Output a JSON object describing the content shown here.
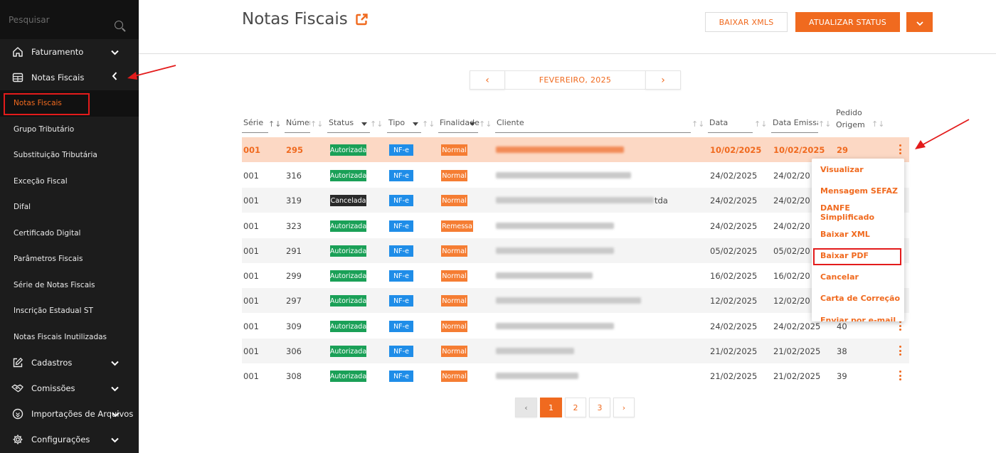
{
  "sidebar": {
    "search_placeholder": "Pesquisar",
    "groups_top": [
      {
        "label": "Faturamento",
        "icon": "home-icon"
      },
      {
        "label": "Notas Fiscais",
        "icon": "invoice-list-icon"
      }
    ],
    "subitems": [
      "Notas Fiscais",
      "Grupo Tributário",
      "Substituição Tributária",
      "Exceção Fiscal",
      "Difal",
      "Certificado Digital",
      "Parâmetros Fiscais",
      "Série de Notas Fiscais",
      "Inscrição Estadual ST",
      "Notas Fiscais Inutilizadas"
    ],
    "groups_bottom": [
      {
        "label": "Cadastros",
        "icon": "edit-icon"
      },
      {
        "label": "Comissões",
        "icon": "handshake-icon"
      },
      {
        "label": "Importações de Arquivos",
        "icon": "import-icon"
      },
      {
        "label": "Configurações",
        "icon": "gear-icon"
      }
    ]
  },
  "header": {
    "title": "Notas Fiscais",
    "download_xmls": "BAIXAR XMLS",
    "update_status": "ATUALIZAR STATUS"
  },
  "month_nav": {
    "label": "FEVEREIRO, 2025",
    "prev": "‹",
    "next": "›"
  },
  "table": {
    "columns": [
      "Série",
      "Númer",
      "Status",
      "Tipo",
      "Finalidade",
      "Cliente",
      "Data",
      "Data Emissao",
      "Pedido",
      "Origem"
    ],
    "rows": [
      {
        "serie": "001",
        "numero": "295",
        "status": "Autorizada",
        "tipo": "NF-e",
        "finalidade": "Normal",
        "cliente_suffix": "",
        "data": "10/02/2025",
        "emissao": "10/02/2025",
        "pedido": "29"
      },
      {
        "serie": "001",
        "numero": "316",
        "status": "Autorizada",
        "tipo": "NF-e",
        "finalidade": "Normal",
        "cliente_suffix": "",
        "data": "24/02/2025",
        "emissao": "24/02/20",
        "pedido": ""
      },
      {
        "serie": "001",
        "numero": "319",
        "status": "Cancelada",
        "tipo": "NF-e",
        "finalidade": "Normal",
        "cliente_suffix": "tda",
        "data": "24/02/2025",
        "emissao": "24/02/20",
        "pedido": ""
      },
      {
        "serie": "001",
        "numero": "323",
        "status": "Autorizada",
        "tipo": "NF-e",
        "finalidade": "Remessa",
        "cliente_suffix": "",
        "data": "24/02/2025",
        "emissao": "24/02/20",
        "pedido": ""
      },
      {
        "serie": "001",
        "numero": "291",
        "status": "Autorizada",
        "tipo": "NF-e",
        "finalidade": "Normal",
        "cliente_suffix": "",
        "data": "05/02/2025",
        "emissao": "05/02/20",
        "pedido": ""
      },
      {
        "serie": "001",
        "numero": "299",
        "status": "Autorizada",
        "tipo": "NF-e",
        "finalidade": "Normal",
        "cliente_suffix": "",
        "data": "16/02/2025",
        "emissao": "16/02/20",
        "pedido": ""
      },
      {
        "serie": "001",
        "numero": "297",
        "status": "Autorizada",
        "tipo": "NF-e",
        "finalidade": "Normal",
        "cliente_suffix": "",
        "data": "12/02/2025",
        "emissao": "12/02/20",
        "pedido": ""
      },
      {
        "serie": "001",
        "numero": "309",
        "status": "Autorizada",
        "tipo": "NF-e",
        "finalidade": "Normal",
        "cliente_suffix": "",
        "data": "24/02/2025",
        "emissao": "24/02/2025",
        "pedido": "40"
      },
      {
        "serie": "001",
        "numero": "306",
        "status": "Autorizada",
        "tipo": "NF-e",
        "finalidade": "Normal",
        "cliente_suffix": "",
        "data": "21/02/2025",
        "emissao": "21/02/2025",
        "pedido": "38"
      },
      {
        "serie": "001",
        "numero": "308",
        "status": "Autorizada",
        "tipo": "NF-e",
        "finalidade": "Normal",
        "cliente_suffix": "",
        "data": "21/02/2025",
        "emissao": "21/02/2025",
        "pedido": "39"
      }
    ]
  },
  "row_menu": {
    "items": [
      "Visualizar",
      "Mensagem SEFAZ",
      "DANFE Simplificado",
      "Baixar XML",
      "Baixar PDF",
      "Cancelar",
      "Carta de Correção",
      "Enviar por e-mail"
    ]
  },
  "pagination": {
    "pages": [
      "1",
      "2",
      "3"
    ],
    "prev": "‹",
    "next": "›"
  },
  "colors": {
    "accent": "#f06a1f",
    "sidebar": "#1c1c1c",
    "highlight_row": "#fcd8c4",
    "annotation": "#e31b1b"
  }
}
